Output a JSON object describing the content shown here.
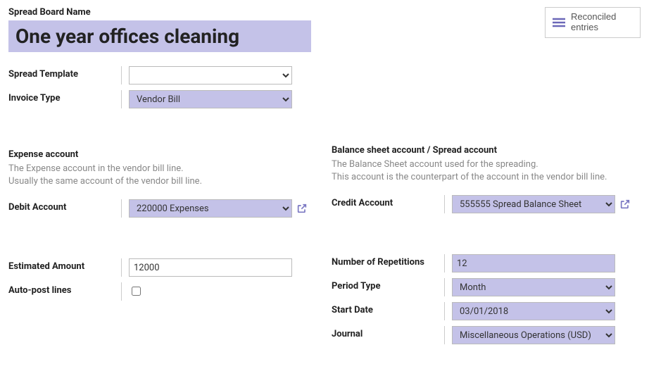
{
  "header": {
    "field_label": "Spread Board Name",
    "title": "One year offices cleaning",
    "reconciled_label": "Reconciled entries"
  },
  "left": {
    "spread_template_label": "Spread Template",
    "spread_template_value": "",
    "invoice_type_label": "Invoice Type",
    "invoice_type_value": "Vendor Bill",
    "expense_section_title": "Expense account",
    "expense_section_desc1": "The Expense account in the vendor bill line.",
    "expense_section_desc2": "Usually the same account of the vendor bill line.",
    "debit_account_label": "Debit Account",
    "debit_account_value": "220000 Expenses",
    "estimated_amount_label": "Estimated Amount",
    "estimated_amount_value": "12000",
    "autopost_label": "Auto-post lines"
  },
  "right": {
    "balance_section_title": "Balance sheet account / Spread account",
    "balance_section_desc1": "The Balance Sheet account used for the spreading.",
    "balance_section_desc2": "This account is the counterpart of the account in the vendor bill line.",
    "credit_account_label": "Credit Account",
    "credit_account_value": "555555 Spread Balance Sheet",
    "num_rep_label": "Number of Repetitions",
    "num_rep_value": "12",
    "period_type_label": "Period Type",
    "period_type_value": "Month",
    "start_date_label": "Start Date",
    "start_date_value": "03/01/2018",
    "journal_label": "Journal",
    "journal_value": "Miscellaneous Operations (USD)"
  }
}
